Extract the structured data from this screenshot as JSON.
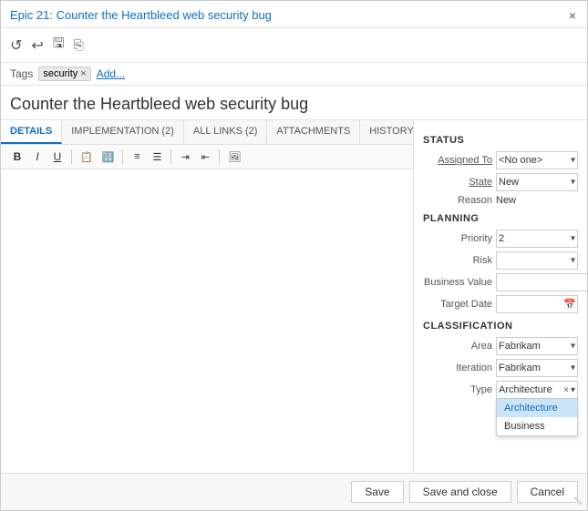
{
  "titleBar": {
    "title": "Epic 21: Counter the Heartbleed web security bug",
    "epicLabel": "Epic 21:",
    "epicTitle": "Counter the Heartbleed web security bug",
    "closeIcon": "×"
  },
  "toolbar": {
    "icons": [
      {
        "name": "refresh-icon",
        "glyph": "↺"
      },
      {
        "name": "undo-icon",
        "glyph": "↩"
      },
      {
        "name": "save-icon",
        "glyph": "💾"
      },
      {
        "name": "copy-icon",
        "glyph": "⎘"
      }
    ]
  },
  "tags": {
    "label": "Tags",
    "items": [
      "security"
    ],
    "addLabel": "Add..."
  },
  "workItemTitle": "Counter the Heartbleed web security bug",
  "tabs": [
    {
      "id": "details",
      "label": "DETAILS",
      "active": true
    },
    {
      "id": "implementation",
      "label": "IMPLEMENTATION (2)",
      "active": false
    },
    {
      "id": "allLinks",
      "label": "ALL LINKS (2)",
      "active": false
    },
    {
      "id": "attachments",
      "label": "ATTACHMENTS",
      "active": false
    },
    {
      "id": "history",
      "label": "HISTORY",
      "active": false
    }
  ],
  "editorToolbar": {
    "buttons": [
      "B",
      "I",
      "U",
      "OL1",
      "OL2",
      "UL1",
      "UL2",
      "IND1",
      "IND2",
      "IMG"
    ]
  },
  "rightPanel": {
    "statusSection": {
      "header": "STATUS",
      "fields": [
        {
          "label": "Assigned To",
          "type": "select",
          "value": "",
          "placeholder": "<No one>",
          "underline": true
        },
        {
          "label": "State",
          "type": "select",
          "value": "New",
          "underline": true
        },
        {
          "label": "Reason",
          "type": "text",
          "value": "New"
        }
      ]
    },
    "planningSection": {
      "header": "PLANNING",
      "fields": [
        {
          "label": "Priority",
          "type": "select",
          "value": "2"
        },
        {
          "label": "Risk",
          "type": "select",
          "value": ""
        },
        {
          "label": "Business Value",
          "type": "input",
          "value": ""
        },
        {
          "label": "Target Date",
          "type": "date",
          "value": ""
        }
      ]
    },
    "classificationSection": {
      "header": "CLASSIFICATION",
      "fields": [
        {
          "label": "Area",
          "type": "select",
          "value": "Fabrikam"
        },
        {
          "label": "Iteration",
          "type": "select",
          "value": "Fabrikam"
        },
        {
          "label": "Type",
          "type": "type-dropdown",
          "value": "Architecture"
        }
      ]
    }
  },
  "typeDropdown": {
    "options": [
      "Architecture",
      "Business"
    ],
    "selectedIndex": 0
  },
  "footer": {
    "saveLabel": "Save",
    "saveCloseLabel": "Save and close",
    "cancelLabel": "Cancel"
  }
}
